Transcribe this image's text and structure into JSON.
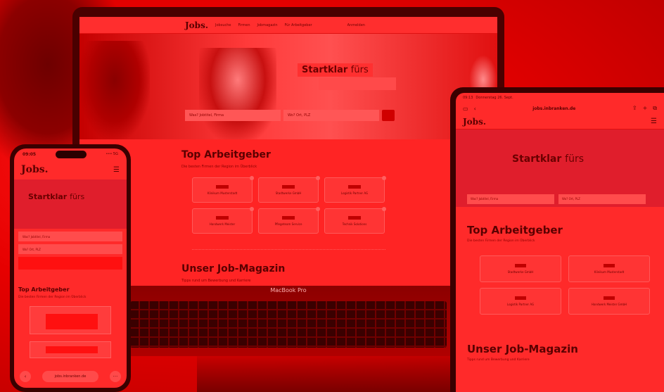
{
  "laptop": {
    "brand": "MacBook Pro",
    "logo": "Jobs.",
    "nav": [
      "Jobsuche",
      "Firmen",
      "Jobmagazin",
      "Für Arbeitgeber"
    ],
    "login": "Anmelden",
    "hero_title_bold": "Startklar",
    "hero_title_light": "fürs",
    "search_what": "Was? Jobtitel, Firma",
    "search_where": "Wo? Ort, PLZ",
    "section_top": "Top Arbeitgeber",
    "section_top_sub": "Die besten Firmen der Region im Überblick",
    "employers": [
      "Klinikum Musterstadt",
      "Stadtwerke GmbH",
      "Logistik Partner AG",
      "Handwerk Meister",
      "Pflegeteam Service",
      "Technik Solutions"
    ],
    "section_magazine": "Unser Job-Magazin",
    "section_magazine_sub": "Tipps rund um Bewerbung und Karriere"
  },
  "phone": {
    "time": "09:05",
    "signal": "••• 5G",
    "logo": "Jobs.",
    "menu_icon": "☰",
    "hero_title_bold": "Startklar",
    "hero_title_light": "fürs",
    "input_what": "Was? Jobtitel, Firma",
    "input_where": "Wo? Ort, PLZ",
    "section_top": "Top Arbeitgeber",
    "section_top_sub": "Die besten Firmen der Region im Überblick",
    "url": "jobs.inbranken.de",
    "back": "‹",
    "more": "···"
  },
  "tablet": {
    "status_time": "09:13",
    "status_date": "Donnerstag 26. Sept.",
    "url": "jobs.inbranken.de",
    "logo": "Jobs.",
    "menu_icon": "☰",
    "hero_title_bold": "Startklar",
    "hero_title_light": "fürs",
    "input_what": "Was? Jobtitel, Firma",
    "input_where": "Wo? Ort, PLZ",
    "section_top": "Top Arbeitgeber",
    "section_top_sub": "Die besten Firmen der Region im Überblick",
    "employers": [
      "Stadtwerke GmbH",
      "Klinikum Musterstadt",
      "Logistik Partner AG",
      "Handwerk Meister GmbH"
    ],
    "section_magazine": "Unser Job-Magazin",
    "section_magazine_sub": "Tipps rund um Bewerbung und Karriere"
  },
  "colors": {
    "background": "#e60000",
    "text_dark": "#5a0000"
  }
}
